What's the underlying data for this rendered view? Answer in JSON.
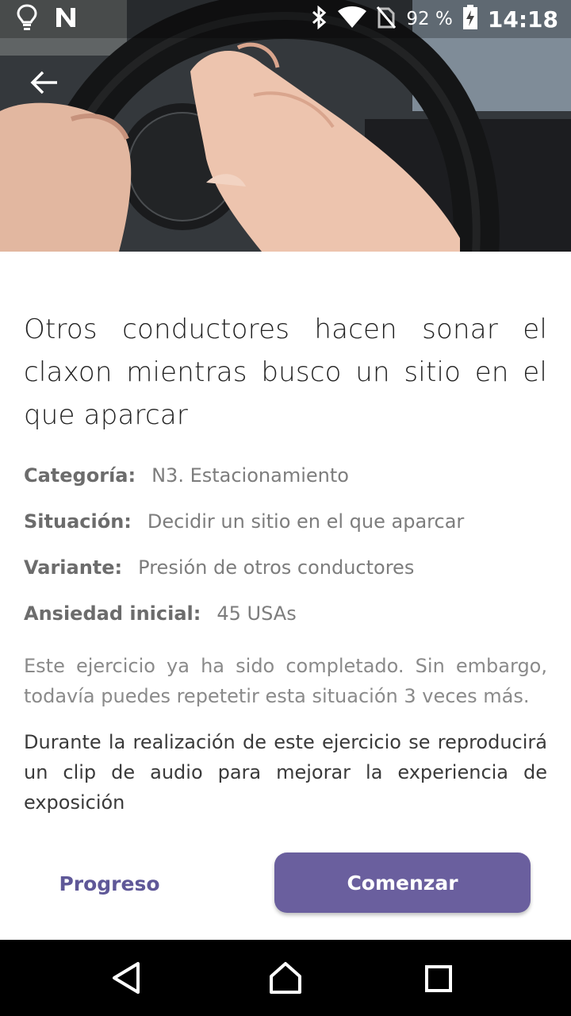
{
  "status_bar": {
    "battery": "92 %",
    "time": "14:18",
    "icons": [
      "lightbulb-icon",
      "n-icon",
      "bluetooth-icon",
      "wifi-icon",
      "no-sim-icon",
      "battery-charging-icon"
    ]
  },
  "header": {
    "back_icon": "arrow-left-icon"
  },
  "exercise": {
    "title": "Otros conductores hacen sonar el claxon mientras busco un sitio en el que aparcar",
    "fields": [
      {
        "label": "Categoría:",
        "value": "N3. Estacionamiento"
      },
      {
        "label": "Situación:",
        "value": "Decidir un sitio en el que aparcar"
      },
      {
        "label": "Variante:",
        "value": "Presión de otros conductores"
      },
      {
        "label": "Ansiedad inicial:",
        "value": "45 USAs"
      }
    ],
    "completed_note": "Este ejercicio ya ha sido completado. Sin embargo, todavía puedes repetetir esta situación 3 veces más.",
    "audio_note": "Durante la realización de este ejercicio se reproducirá un clip de audio para mejorar la experiencia de exposición"
  },
  "actions": {
    "progress_label": "Progreso",
    "start_label": "Comenzar"
  },
  "nav": {
    "icons": [
      "back-triangle-icon",
      "home-icon",
      "recents-square-icon"
    ]
  },
  "colors": {
    "accent": "#6a5f9e",
    "accent_text": "#5f5898"
  }
}
